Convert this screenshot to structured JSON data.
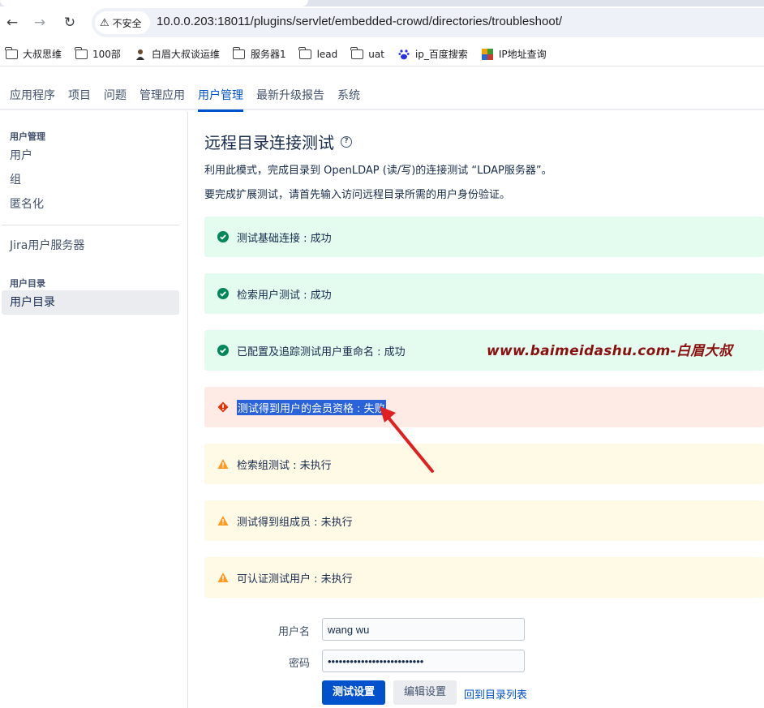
{
  "browser": {
    "security_label": "不安全",
    "url": "10.0.0.203:18011/plugins/servlet/embedded-crowd/directories/troubleshoot/"
  },
  "bookmarks": [
    {
      "label": "大叔思维",
      "icon": "folder-icon"
    },
    {
      "label": "100部",
      "icon": "folder-icon"
    },
    {
      "label": "白眉大叔谈运维",
      "icon": "person-icon"
    },
    {
      "label": "服务器1",
      "icon": "folder-icon"
    },
    {
      "label": "lead",
      "icon": "folder-icon"
    },
    {
      "label": "uat",
      "icon": "folder-icon"
    },
    {
      "label": "ip_百度搜索",
      "icon": "baidu-icon"
    },
    {
      "label": "IP地址查询",
      "icon": "ip-icon"
    }
  ],
  "app_nav": [
    {
      "label": "应用程序",
      "active": false
    },
    {
      "label": "项目",
      "active": false
    },
    {
      "label": "问题",
      "active": false
    },
    {
      "label": "管理应用",
      "active": false
    },
    {
      "label": "用户管理",
      "active": true
    },
    {
      "label": "最新升级报告",
      "active": false
    },
    {
      "label": "系统",
      "active": false
    }
  ],
  "sidebar": {
    "section1_heading": "用户管理",
    "item_users": "用户",
    "item_groups": "组",
    "item_anonymize": "匿名化",
    "item_jira_servers": "Jira用户服务器",
    "section2_heading": "用户目录",
    "item_directories": "用户目录"
  },
  "main": {
    "title": "远程目录连接测试",
    "desc1": "利用此模式，完成目录到 OpenLDAP (读/写)的连接测试 “LDAP服务器”。",
    "desc2": "要完成扩展测试，请首先输入访问远程目录所需的用户身份验证。",
    "results": [
      {
        "text": "测试基础连接 : 成功",
        "status": "success"
      },
      {
        "text": "检索用户测试 : 成功",
        "status": "success"
      },
      {
        "text": "已配置及追踪测试用户重命名 : 成功",
        "status": "success"
      },
      {
        "text": "测试得到用户的会员资格 : 失败",
        "status": "error"
      },
      {
        "text": "检索组测试 : 未执行",
        "status": "warning"
      },
      {
        "text": "测试得到组成员 : 未执行",
        "status": "warning"
      },
      {
        "text": "可认证测试用户 : 未执行",
        "status": "warning"
      }
    ],
    "watermark": "www.baimeidashu.com-白眉大叔",
    "form": {
      "username_label": "用户名",
      "username_value": "wang wu",
      "password_label": "密码",
      "password_value": "••••••••••••••••••••••••••",
      "test_button": "测试设置",
      "edit_button": "编辑设置",
      "back_link": "回到目录列表"
    }
  },
  "colors": {
    "accent": "#0052cc",
    "success_bg": "#e3fcef",
    "error_bg": "#ffebe6",
    "warning_bg": "#fffae6",
    "success_icon": "#00875a",
    "error_icon": "#de350b",
    "warning_icon": "#ff991f",
    "annotation_arrow": "#e02020"
  }
}
